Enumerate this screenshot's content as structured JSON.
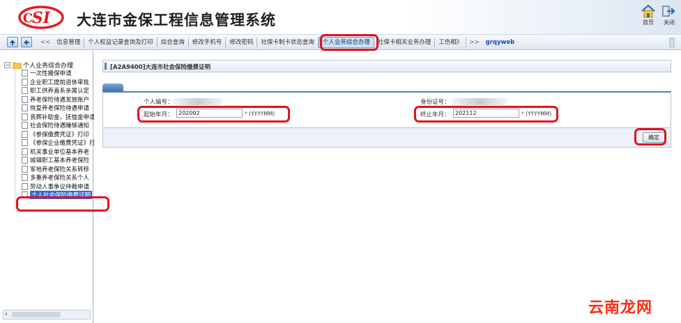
{
  "header": {
    "title": "大连市金保工程信息管理系统",
    "home_label": "首页",
    "exit_label": "关闭"
  },
  "toolbar": {
    "tabs": [
      {
        "label": "<<",
        "sep": true
      },
      {
        "label": "信息管理"
      },
      {
        "label": "个人权益记录查询及打印"
      },
      {
        "label": "综合查询"
      },
      {
        "label": "修改手机号"
      },
      {
        "label": "修改密码"
      },
      {
        "label": "社保卡制卡状态查询"
      },
      {
        "label": "个人业务综合办理",
        "active": true
      },
      {
        "label": "社保卡相关业务办理"
      },
      {
        "label": "工伤相》"
      },
      {
        "label": ">>",
        "sep": true
      },
      {
        "label": "grqyweb",
        "user": true
      }
    ]
  },
  "sidebar": {
    "root_label": "个人业务综合办理",
    "items": [
      {
        "label": "一次性搬保申请"
      },
      {
        "label": "企业职工提前退休审批"
      },
      {
        "label": "职工供养直系亲属认定"
      },
      {
        "label": "养老保险待遇发放账户"
      },
      {
        "label": "恢复养老保险待遇申请"
      },
      {
        "label": "丧葬补助金、抚恤金申请"
      },
      {
        "label": "社会保险待遇睡够通知"
      },
      {
        "label": "《参保缴费凭证》打印"
      },
      {
        "label": "《参保企业缴费凭证》打印"
      },
      {
        "label": "机关事业单位基本养老"
      },
      {
        "label": "城镇职工基本养老保险"
      },
      {
        "label": "军地养老保险关系转移"
      },
      {
        "label": "多重养老保险关系个人"
      },
      {
        "label": "劳动人事争议仲裁申请"
      },
      {
        "label": "个人社会保险缴费证明",
        "selected": true
      }
    ]
  },
  "main": {
    "title": "[A2A9400]大连市社会保险缴费证明",
    "form": {
      "person_id_label": "个人编号：",
      "id_card_label": "身份证号：",
      "start_month_label": "起始年月：",
      "start_month_value": "202002",
      "end_month_label": "终止年月：",
      "end_month_value": "202112",
      "required_mark": "*",
      "format_hint": "(YYYYMM)"
    },
    "confirm_label": "确定"
  },
  "watermark": "云南龙网",
  "colors": {
    "annotation": "#e3101f",
    "selected_item": "#2f6bd2",
    "logo_red": "#e31b23"
  }
}
